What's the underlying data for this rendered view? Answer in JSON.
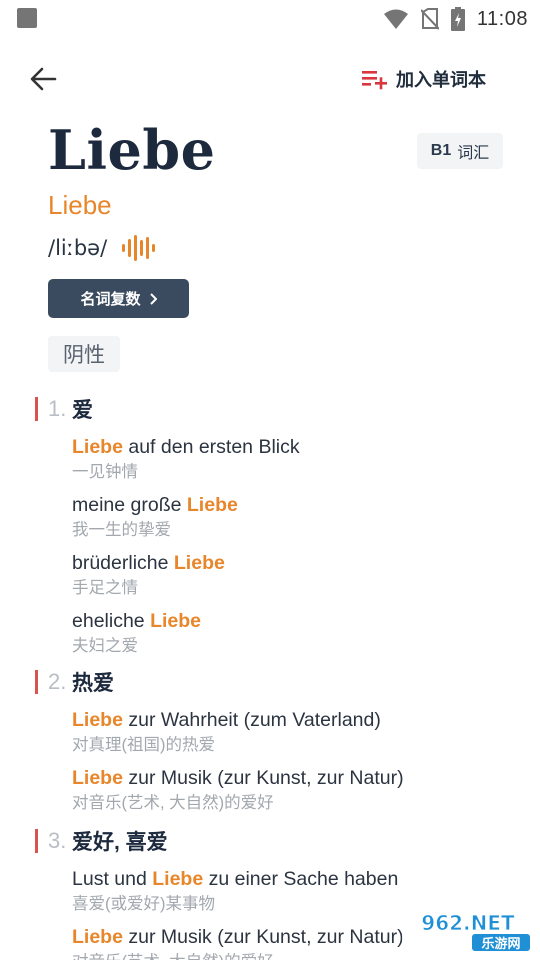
{
  "status_bar": {
    "time": "11:08"
  },
  "header": {
    "add_wordbook_label": "加入单词本"
  },
  "entry": {
    "headword": "Liebe",
    "level": "B1",
    "level_label": "词汇",
    "word_form": "Liebe",
    "ipa": "/liːbə/",
    "plural_button_label": "名词复数",
    "gender": "阴性"
  },
  "senses": [
    {
      "number": "1.",
      "definition": "爱",
      "examples": [
        {
          "pre": "",
          "hl": "Liebe",
          "post": " auf den ersten Blick",
          "zh": "一见钟情"
        },
        {
          "pre": "meine große ",
          "hl": "Liebe",
          "post": "",
          "zh": "我一生的挚爱"
        },
        {
          "pre": "brüderliche ",
          "hl": "Liebe",
          "post": "",
          "zh": "手足之情"
        },
        {
          "pre": "eheliche ",
          "hl": "Liebe",
          "post": "",
          "zh": "夫妇之爱"
        }
      ]
    },
    {
      "number": "2.",
      "definition": "热爱",
      "examples": [
        {
          "pre": "",
          "hl": "Liebe",
          "post": " zur Wahrheit (zum Vaterland)",
          "zh": "对真理(祖国)的热爱"
        },
        {
          "pre": "",
          "hl": "Liebe",
          "post": " zur Musik (zur Kunst, zur Natur)",
          "zh": "对音乐(艺术, 大自然)的爱好"
        }
      ]
    },
    {
      "number": "3.",
      "definition": "爱好, 喜爱",
      "examples": [
        {
          "pre": "Lust und ",
          "hl": "Liebe",
          "post": " zu einer Sache haben",
          "zh": "喜爱(或爱好)某事物"
        },
        {
          "pre": "",
          "hl": "Liebe",
          "post": " zur Musik (zur Kunst, zur Natur)",
          "zh": "对音乐(艺术, 大自然)的爱好"
        }
      ]
    }
  ],
  "watermark": {
    "top": "962.NET",
    "bottom": "乐游网"
  },
  "colors": {
    "accent_orange": "#e8862b",
    "accent_red": "#d9534f",
    "button_dark": "#3b4b5f",
    "text_dark": "#1d2a3e"
  }
}
